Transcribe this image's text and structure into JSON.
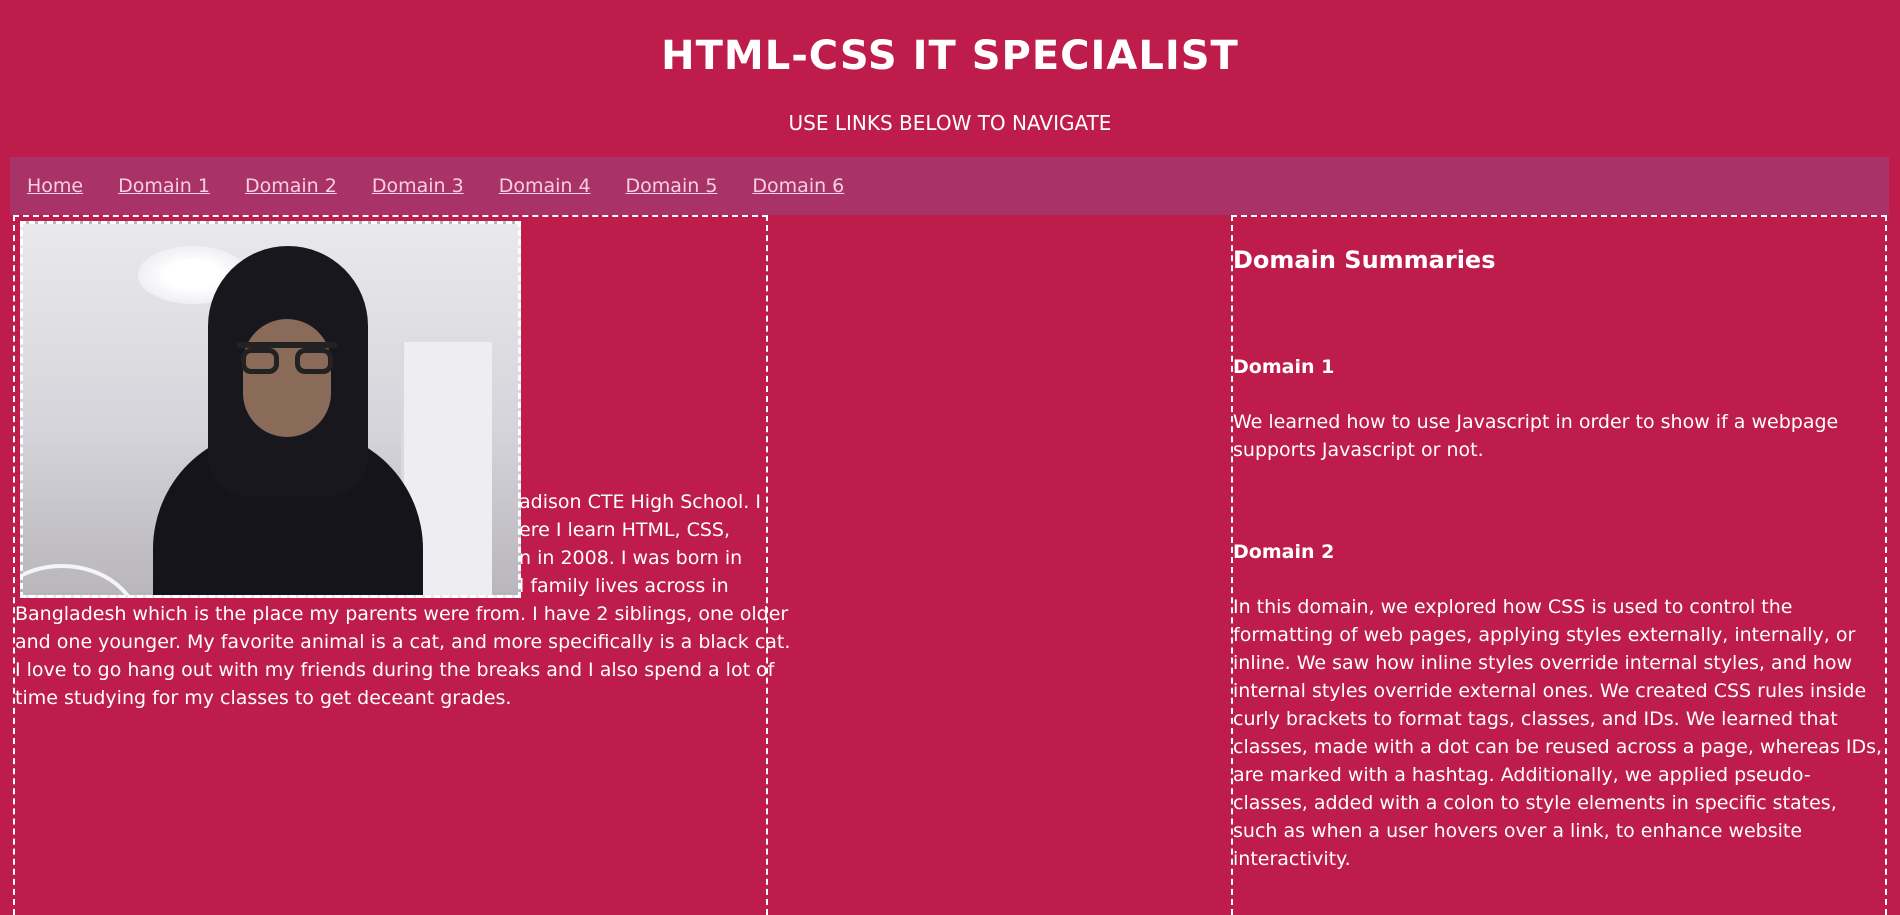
{
  "header": {
    "title": "HTML-CSS IT SPECIALIST",
    "subtitle": "USE LINKS BELOW TO NAVIGATE"
  },
  "nav": {
    "links": [
      "Home",
      "Domain 1",
      "Domain 2",
      "Domain 3",
      "Domain 4",
      "Domain 5",
      "Domain 6"
    ]
  },
  "bio": {
    "line1": "adison CTE High School. I",
    "line2": "ere I learn HTML, CSS,",
    "line3": "n in 2008. I was born in",
    "line4": "l family lives across in",
    "line5": "Bangladesh which is the place my parents were from. I have 2 siblings, one older",
    "line6": "and one younger. My favorite animal is a cat, and more specifically is a black cat.",
    "line7": "I love to go hang out with my friends during the breaks and I also spend a lot of",
    "line8": "time studying for my classes to get deceant grades."
  },
  "summaries": {
    "title": "Domain Summaries",
    "domains": [
      {
        "heading": "Domain 1",
        "text": "We learned how to use Javascript in order to show if a webpage supports Javascript or not."
      },
      {
        "heading": "Domain 2",
        "text": "In this domain, we explored how CSS is used to control the formatting of web pages, applying styles externally, internally, or inline. We saw how inline styles override internal styles, and how internal styles override external ones. We created CSS rules inside curly brackets to format tags, classes, and IDs. We learned that classes, made with a dot can be reused across a page, whereas IDs, are marked with a hashtag. Additionally, we applied pseudo-classes, added with a colon to style elements in specific states, such as when a user hovers over a link, to enhance website interactivity."
      }
    ]
  },
  "colors": {
    "background": "#be1c4a",
    "navbar": "#a93367",
    "link": "#f7cfe0"
  }
}
